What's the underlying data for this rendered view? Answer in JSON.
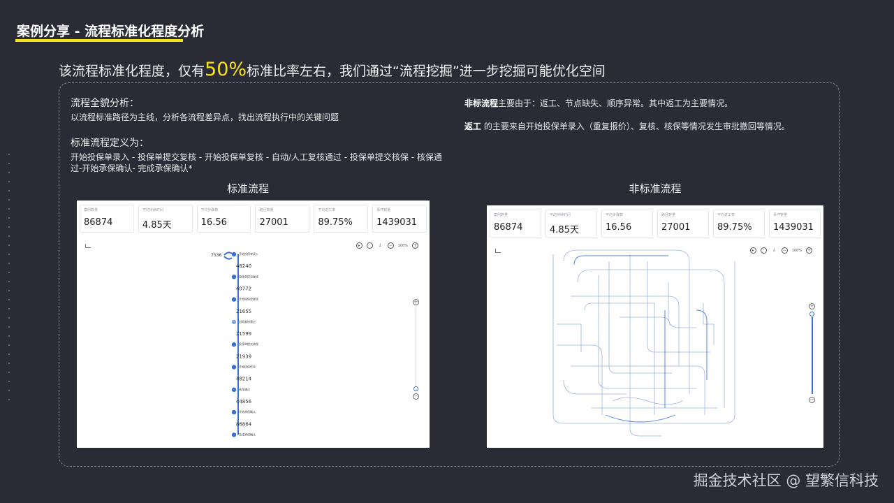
{
  "slide": {
    "title": "案例分享 - 流程标准化程度分析",
    "headline_before": "该流程标准化程度，仅有",
    "headline_highlight": "50%",
    "headline_after": "标准比率左右，我们通过“流程挖掘”进一步挖掘可能优化空间"
  },
  "left_notes": {
    "overview_heading": "流程全貌分析：",
    "overview_text": "以流程标准路径为主线，分析各流程差异点，找出流程执行中的关键问题",
    "definition_heading": "标准流程定义为：",
    "definition_text": "开始投保单录入 - 投保单提交复核 - 开始投保单复核 - 自动/人工复核通过 - 投保单提交核保 - 核保通过-开始承保确认- 完成承保确认*"
  },
  "right_notes": {
    "p1_bold": "非标流程",
    "p1_text": "主要由于：返工、节点缺失、顺序异常。其中返工为主要情况。",
    "p2_bold": "返工",
    "p2_text": " 的主要来自开始投保单录入（重复报价）、复核、核保等情况发生审批撤回等情况。"
  },
  "captions": {
    "standard": "标准流程",
    "nonstandard": "非标准流程"
  },
  "standard_panel": {
    "metrics": [
      {
        "label": "案例数量",
        "value": "86874"
      },
      {
        "label": "平均持续时间",
        "value": "4.85天"
      },
      {
        "label": "平均步骤数",
        "value": "16.56"
      },
      {
        "label": "路径数量",
        "value": "27001"
      },
      {
        "label": "平均返工率",
        "value": "89.75%"
      },
      {
        "label": "事件数量",
        "value": "1439031"
      }
    ],
    "zoom": "100%",
    "start_count": "7536",
    "flow_counts": [
      "48240",
      "40772",
      "21655",
      "21599",
      "21939",
      "48214",
      "44856",
      "86864"
    ],
    "nodes": [
      "开始投保单录入",
      "投保单提交复核",
      "开始投保单复核",
      "自动复核通过",
      "投保单提交核保",
      "开始核保作业",
      "核保通过",
      "开始承保确认",
      "完成承保确认"
    ]
  },
  "nonstandard_panel": {
    "metrics": [
      {
        "label": "案例数量",
        "value": "86874"
      },
      {
        "label": "平均持续时间",
        "value": "4.85天"
      },
      {
        "label": "平均步骤数",
        "value": "16.56"
      },
      {
        "label": "路径数量",
        "value": "27001"
      },
      {
        "label": "平均返工率",
        "value": "89.75%"
      },
      {
        "label": "事件数量",
        "value": "1439031"
      }
    ],
    "zoom": "100%"
  },
  "watermark": "掘金技术社区 @ 望繁信科技",
  "colors": {
    "accent": "#f5e31a",
    "flow_blue": "#3b6fd8",
    "background": "#2a2b35"
  }
}
